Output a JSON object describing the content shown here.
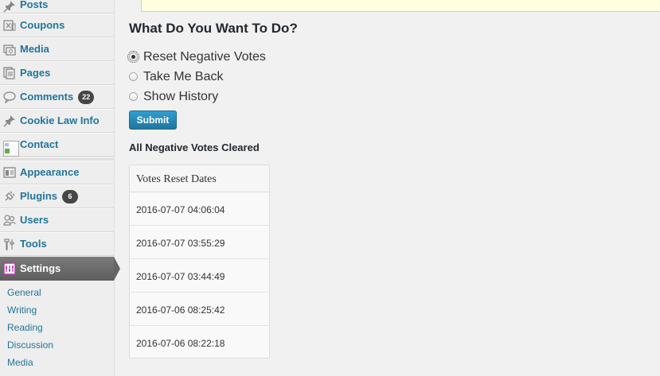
{
  "sidebar": {
    "items": [
      {
        "label": "Posts",
        "icon": "pushpin-icon"
      },
      {
        "label": "Coupons",
        "icon": "coupon-icon"
      },
      {
        "label": "Media",
        "icon": "media-icon"
      },
      {
        "label": "Pages",
        "icon": "pages-icon"
      },
      {
        "label": "Comments",
        "icon": "comment-icon",
        "badge": "22"
      },
      {
        "label": "Cookie Law Info",
        "icon": "pushpin-icon"
      },
      {
        "label": "Contact",
        "icon": "broken-image-icon"
      },
      {
        "label": "Appearance",
        "icon": "appearance-icon"
      },
      {
        "label": "Plugins",
        "icon": "plugin-icon",
        "badge": "6"
      },
      {
        "label": "Users",
        "icon": "users-icon"
      },
      {
        "label": "Tools",
        "icon": "tools-icon"
      },
      {
        "label": "Settings",
        "icon": "settings-icon",
        "active": true
      }
    ],
    "submenu": [
      "General",
      "Writing",
      "Reading",
      "Discussion",
      "Media"
    ]
  },
  "main": {
    "heading": "What Do You Want To Do?",
    "options": [
      {
        "label": "Reset Negative Votes",
        "checked": true
      },
      {
        "label": "Take Me Back",
        "checked": false
      },
      {
        "label": "Show History",
        "checked": false
      }
    ],
    "submit_label": "Submit",
    "status_message": "All Negative Votes Cleared",
    "table": {
      "header": "Votes Reset Dates",
      "rows": [
        "2016-07-07 04:06:04",
        "2016-07-07 03:55:29",
        "2016-07-07 03:44:49",
        "2016-07-06 08:25:42",
        "2016-07-06 08:22:18"
      ]
    }
  },
  "colors": {
    "link": "#21759b",
    "button": "#2e9fd2",
    "active_menu": "#6d6d6d",
    "notice_bg": "#ffffe0"
  }
}
